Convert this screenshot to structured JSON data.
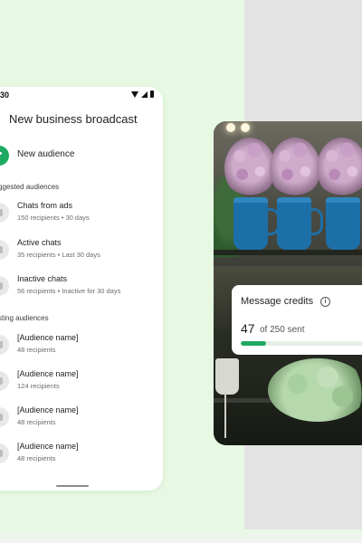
{
  "status_bar": {
    "time": "30"
  },
  "header": {
    "title": "New business broadcast"
  },
  "new_audience": {
    "label": "New audience"
  },
  "suggested": {
    "heading": "ggested audiences",
    "items": [
      {
        "title": "Chats from ads",
        "subtitle": "150 recipients • 30 days",
        "icon": "megaphone-icon"
      },
      {
        "title": "Active chats",
        "subtitle": "35 recipients • Last 30 days",
        "icon": "chat-icon"
      },
      {
        "title": "Inactive chats",
        "subtitle": "56 recipients • Inactive for 30 days",
        "icon": "chat-icon"
      }
    ]
  },
  "existing": {
    "heading": "sting audiences",
    "items": [
      {
        "title": "[Audience name]",
        "subtitle": "48 recipients",
        "icon": "tag-icon"
      },
      {
        "title": "[Audience name]",
        "subtitle": "124 recipients",
        "icon": "tag-icon"
      },
      {
        "title": "[Audience name]",
        "subtitle": "48 recipients",
        "icon": "tag-icon"
      },
      {
        "title": "[Audience name]",
        "subtitle": "48 recipients",
        "icon": "tag-icon"
      }
    ]
  },
  "credits": {
    "title": "Message credits",
    "info_icon": "info-icon",
    "count": "47",
    "of_text": "of 250 sent",
    "progress_fraction": 0.188,
    "accent": "#1daa61"
  },
  "colors": {
    "background_left": "#e7f9e3",
    "background_right": "#e3e3e3",
    "accent": "#1daa61"
  }
}
